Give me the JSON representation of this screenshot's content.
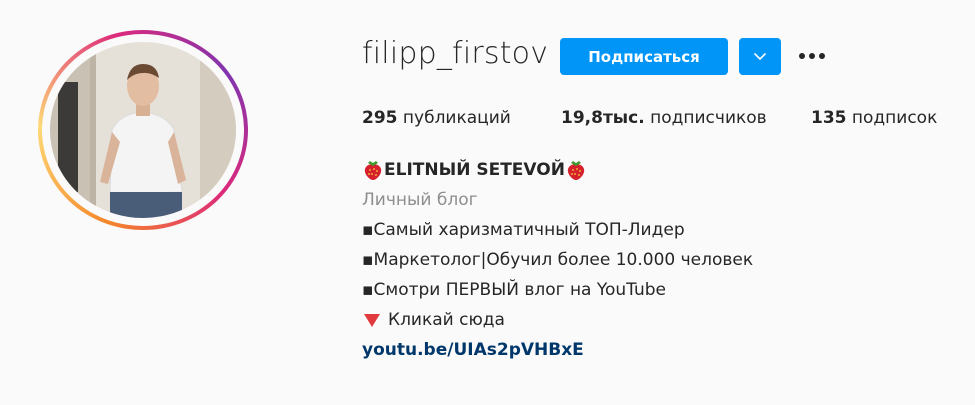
{
  "profile": {
    "username": "filipp_firstov",
    "follow_label": "Подписаться",
    "stats": {
      "posts_count": "295",
      "posts_label": "публикаций",
      "followers_count": "19,8тыс.",
      "followers_label": "подписчиков",
      "following_count": "135",
      "following_label": "подписок"
    },
    "bio": {
      "name": "ELITNЫЙ SETEVOЙ",
      "category": "Личный блог",
      "lines": [
        "▪Самый харизматичный ТОП-Лидер",
        "▪Маркетолог|Обучил более 10.000 человек",
        "▪Смотри ПЕРВЫЙ влог на YouTube"
      ],
      "cta": "Кликай сюда",
      "link": "youtu.be/UIAs2pVHBxE"
    }
  },
  "icons": {
    "name_prefix": "strawberry-icon",
    "name_suffix": "strawberry-icon",
    "cta": "red-triangle-down-icon",
    "dropdown": "chevron-down-icon",
    "more": "more-dots-icon"
  },
  "colors": {
    "primary_button": "#0095f6",
    "link": "#00376b",
    "muted": "#8e8e8e",
    "text": "#262626",
    "background": "#fafafa"
  }
}
